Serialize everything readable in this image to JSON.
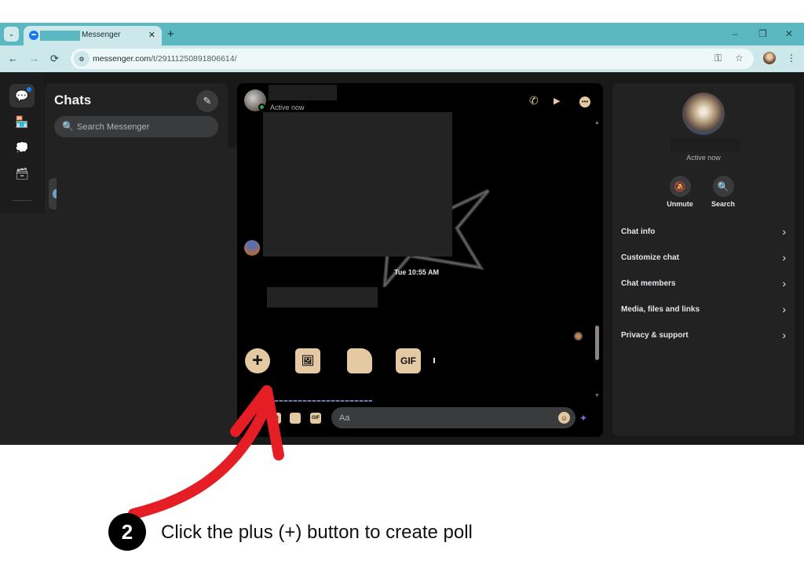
{
  "browser": {
    "tab": {
      "title": "Messenger",
      "close_glyph": "✕"
    },
    "tab_search_glyph": "⌄",
    "new_tab_glyph": "+",
    "window_controls": {
      "minimize": "–",
      "restore": "❐",
      "close": "✕"
    },
    "nav": {
      "back": "←",
      "forward": "→",
      "reload": "⟳"
    },
    "url": {
      "host": "messenger.com",
      "path": "/t/29111250891806614/"
    },
    "omnibox_icons": {
      "password_key": "⚿",
      "bookmark_star": "☆"
    },
    "menu_glyph": "⋮"
  },
  "rail": {
    "items": [
      {
        "name": "chats",
        "glyph": "💬",
        "active": true,
        "badge": true
      },
      {
        "name": "marketplace",
        "glyph": "🏪",
        "active": false
      },
      {
        "name": "message-requests",
        "glyph": "💭",
        "active": false
      },
      {
        "name": "archive",
        "glyph": "🗃",
        "active": false
      }
    ]
  },
  "chats_panel": {
    "title": "Chats",
    "compose_glyph": "✎",
    "search_placeholder": "Search Messenger",
    "search_glyph": "🔍"
  },
  "conversation": {
    "status": "Active now",
    "header_icons": {
      "call": "✆",
      "video": "▶",
      "more": "•••"
    },
    "timestamp": "Tue 10:55 AM",
    "scroll_up_glyph": "▲",
    "scroll_down_glyph": "▼",
    "big_actions": {
      "plus": "+",
      "photo": "🖼",
      "sticker": "",
      "gif": "GIF"
    },
    "composer": {
      "placeholder": "Aa",
      "icons": {
        "photo": "🖼",
        "sticker": "",
        "gif": "GIF"
      },
      "emoji_glyph": "☺",
      "quick_reaction_glyph": "✦"
    }
  },
  "info_panel": {
    "status": "Active now",
    "actions": [
      {
        "label": "Unmute",
        "glyph": "🔕"
      },
      {
        "label": "Search",
        "glyph": "🔍"
      }
    ],
    "rows": [
      {
        "label": "Chat info"
      },
      {
        "label": "Customize chat"
      },
      {
        "label": "Chat members"
      },
      {
        "label": "Media, files and links"
      },
      {
        "label": "Privacy & support"
      }
    ],
    "chevron": "›"
  },
  "annotation": {
    "step_number": "2",
    "instruction": "Click the plus (+) button to create poll",
    "arrow_color": "#e51d25"
  }
}
